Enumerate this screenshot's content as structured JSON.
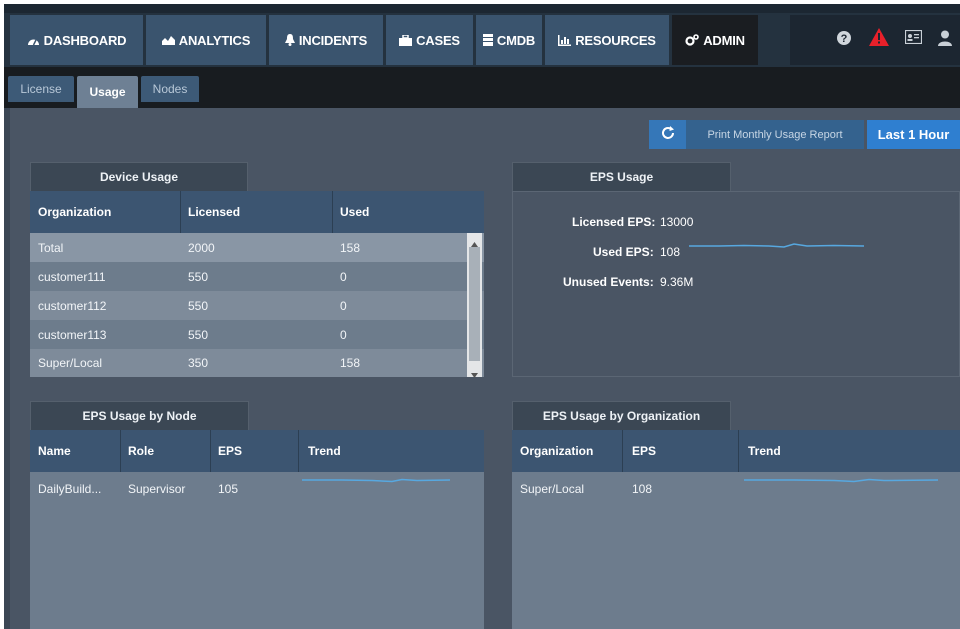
{
  "nav": {
    "items": [
      {
        "label": "DASHBOARD",
        "icon": "dashboard-icon"
      },
      {
        "label": "ANALYTICS",
        "icon": "chart-icon"
      },
      {
        "label": "INCIDENTS",
        "icon": "bell-icon"
      },
      {
        "label": "CASES",
        "icon": "briefcase-icon"
      },
      {
        "label": "CMDB",
        "icon": "database-icon"
      },
      {
        "label": "RESOURCES",
        "icon": "bar-chart-icon"
      },
      {
        "label": "ADMIN",
        "icon": "gears-icon"
      }
    ],
    "active": "ADMIN",
    "right_icons": [
      "help-icon",
      "warning-icon",
      "id-card-icon",
      "user-icon"
    ],
    "colors": {
      "warning": "#e8202a"
    }
  },
  "subtabs": {
    "items": [
      "License",
      "Usage",
      "Nodes"
    ],
    "active": "Usage"
  },
  "toolbar": {
    "print_label": "Print Monthly Usage Report",
    "range_label": "Last 1 Hour",
    "refresh_icon": "refresh-icon"
  },
  "device_usage": {
    "title": "Device Usage",
    "columns": [
      "Organization",
      "Licensed",
      "Used"
    ],
    "rows": [
      {
        "org": "Total",
        "licensed": "2000",
        "used": "158"
      },
      {
        "org": "customer111",
        "licensed": "550",
        "used": "0"
      },
      {
        "org": "customer112",
        "licensed": "550",
        "used": "0"
      },
      {
        "org": "customer113",
        "licensed": "550",
        "used": "0"
      },
      {
        "org": "Super/Local",
        "licensed": "350",
        "used": "158"
      }
    ]
  },
  "eps_usage": {
    "title": "EPS Usage",
    "licensed_label": "Licensed EPS:",
    "licensed_value": "13000",
    "used_label": "Used EPS:",
    "used_value": "108",
    "unused_label": "Unused Events:",
    "unused_value": "9.36M"
  },
  "eps_by_node": {
    "title": "EPS Usage by Node",
    "columns": [
      "Name",
      "Role",
      "EPS",
      "Trend"
    ],
    "rows": [
      {
        "name": "DailyBuild...",
        "role": "Supervisor",
        "eps": "105"
      }
    ]
  },
  "eps_by_org": {
    "title": "EPS Usage by Organization",
    "columns": [
      "Organization",
      "EPS",
      "Trend"
    ],
    "rows": [
      {
        "org": "Super/Local",
        "eps": "108"
      }
    ]
  }
}
